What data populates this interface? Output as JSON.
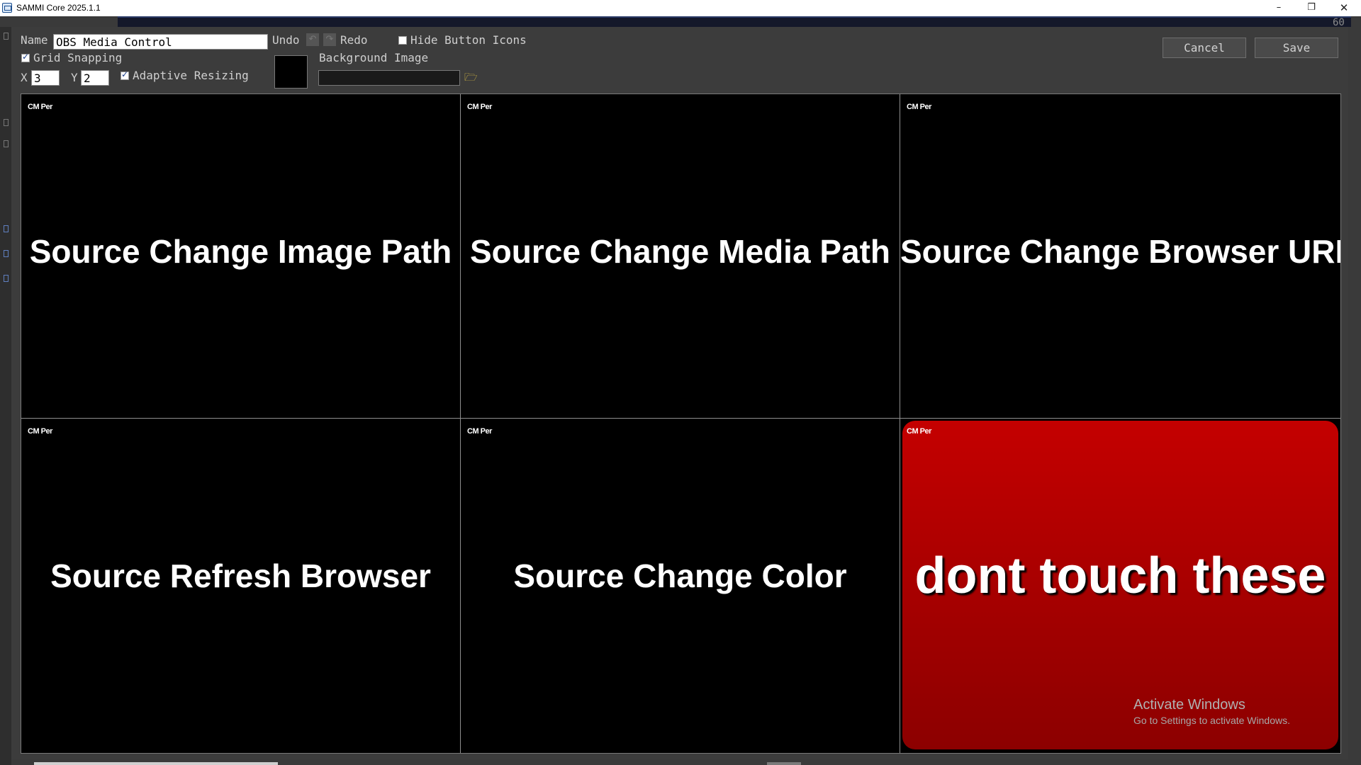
{
  "window": {
    "title": "SAMMI Core 2025.1.1",
    "min_glyph": "–",
    "max_glyph": "❐",
    "close_glyph": "✕"
  },
  "background_app": {
    "fps_readout": "60"
  },
  "editor": {
    "name_label": "Name",
    "name_value": "OBS Media Control",
    "undo_label": "Undo",
    "redo_label": "Redo",
    "undo_glyph": "↶",
    "redo_glyph": "↷",
    "hide_button_icons_label": "Hide Button Icons",
    "hide_button_icons_checked": false,
    "grid_snapping_label": "Grid Snapping",
    "grid_snapping_checked": true,
    "x_label": "X",
    "x_value": "3",
    "y_label": "Y",
    "y_value": "2",
    "adaptive_resizing_label": "Adaptive Resizing",
    "adaptive_resizing_checked": true,
    "background_color": "#000000",
    "background_image_label": "Background Image",
    "background_image_value": "",
    "folder_glyph": "🗁",
    "cancel_label": "Cancel",
    "save_label": "Save"
  },
  "deck": {
    "badge_text": "CM Per",
    "buttons": [
      {
        "label": "Source Change Image Path",
        "style": "normal"
      },
      {
        "label": "Source Change Media Path",
        "style": "normal"
      },
      {
        "label": "Source Change Browser URL",
        "style": "normal"
      },
      {
        "label": "Source Refresh Browser",
        "style": "normal"
      },
      {
        "label": "Source Change Color",
        "style": "normal"
      },
      {
        "label": "dont touch these",
        "style": "danger",
        "color": "#c00000"
      }
    ]
  },
  "watermark": {
    "title": "Activate Windows",
    "subtitle": "Go to Settings to activate Windows."
  }
}
